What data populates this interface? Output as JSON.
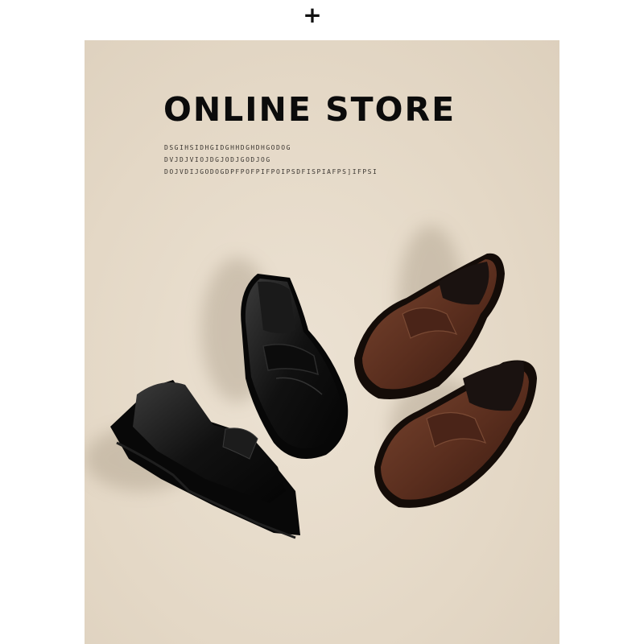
{
  "header": {
    "plus_symbol": "+"
  },
  "banner": {
    "title": "ONLINE STORE",
    "sublines": [
      "DSGIHSIDHGIDGHHDGHDHGODOG",
      "DVJDJVIOJDGJODJGODJOG",
      "DOJVDIJGODOGDPFPOFPIFPOIPSDFISPIAFPS]IFPSI"
    ]
  },
  "colors": {
    "background_panel": "#e4d8c6",
    "black_leather": "#141414",
    "brown_leather": "#5a2e1e"
  },
  "products": [
    {
      "name": "black-loafer",
      "color": "black"
    },
    {
      "name": "brown-loafer",
      "color": "brown"
    }
  ]
}
